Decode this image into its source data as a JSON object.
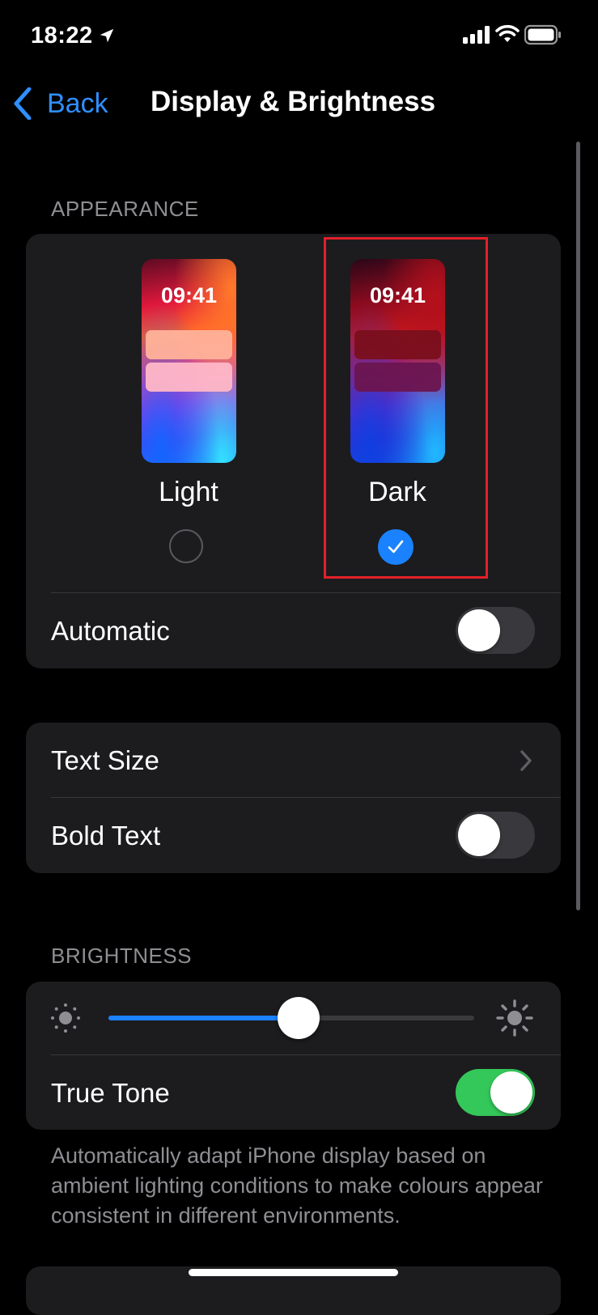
{
  "status_bar": {
    "time": "18:22",
    "icons": [
      "location-arrow-icon",
      "cellular-signal-icon",
      "wifi-icon",
      "battery-icon"
    ]
  },
  "nav": {
    "back_label": "Back",
    "title": "Display & Brightness"
  },
  "appearance": {
    "header": "APPEARANCE",
    "preview_time": "09:41",
    "options": [
      {
        "label": "Light",
        "selected": false
      },
      {
        "label": "Dark",
        "selected": true
      }
    ],
    "automatic_label": "Automatic",
    "automatic_on": false
  },
  "text_settings": {
    "text_size_label": "Text Size",
    "bold_text_label": "Bold Text",
    "bold_text_on": false
  },
  "brightness": {
    "header": "BRIGHTNESS",
    "level": 0.52,
    "true_tone_label": "True Tone",
    "true_tone_on": true,
    "footer": "Automatically adapt iPhone display based on ambient lighting conditions to make colours appear consistent in different environments."
  },
  "colors": {
    "accent": "#1a82ff",
    "toggle_on": "#34c759",
    "highlight": "#e3202a",
    "card": "#1c1c1e"
  }
}
